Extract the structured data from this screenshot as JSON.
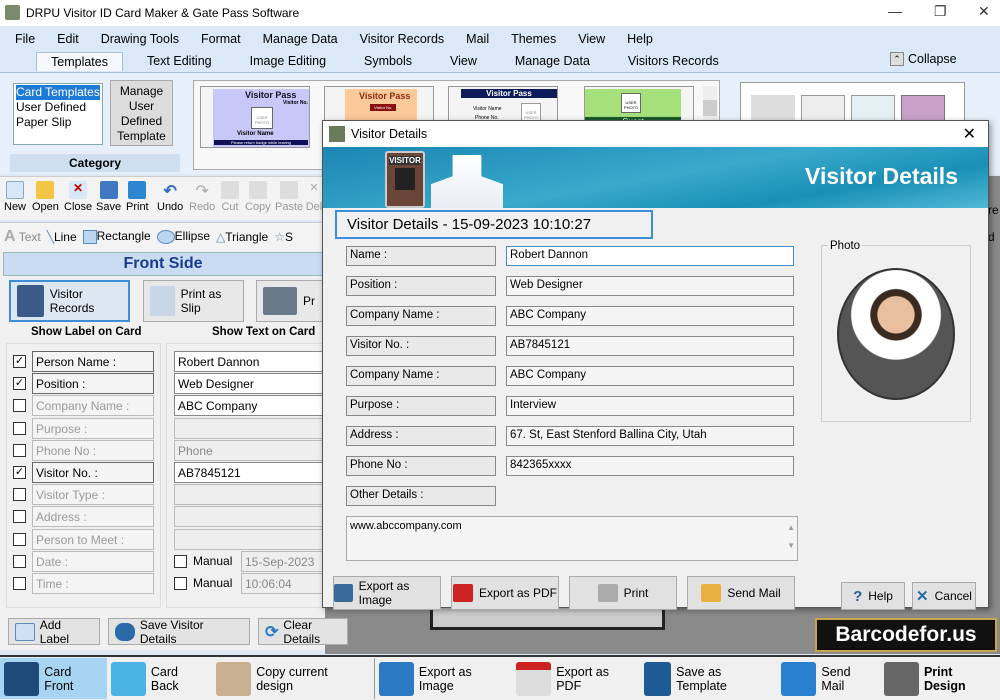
{
  "app": {
    "title": "DRPU Visitor ID Card Maker & Gate Pass Software"
  },
  "menu": [
    "File",
    "Edit",
    "Drawing Tools",
    "Format",
    "Manage Data",
    "Visitor Records",
    "Mail",
    "Themes",
    "View",
    "Help"
  ],
  "ribbon_tabs": [
    "Templates",
    "Text Editing",
    "Image Editing",
    "Symbols",
    "View",
    "Manage Data",
    "Visitors Records"
  ],
  "collapse_label": "Collapse",
  "category": {
    "items": [
      "Card Templates",
      "User Defined",
      "Paper Slip"
    ],
    "manage_button": "Manage User Defined Template",
    "label": "Category"
  },
  "templates": [
    {
      "title": "Visitor Pass",
      "sub": "Visitor No.",
      "name": "Visitor Name",
      "photo": "USER PHOTO",
      "footer": "Please return badge while leaving"
    },
    {
      "title": "Visitor Pass",
      "sub": "Visitor No."
    },
    {
      "title": "Visitor Pass",
      "name": "Visitor Name",
      "phone": "Phone No.",
      "photo": "USER PHOTO"
    },
    {
      "title": "Guest",
      "photo": "USER PHOTO"
    }
  ],
  "toolbar": [
    "New",
    "Open",
    "Close",
    "Save",
    "Print",
    "Undo",
    "Redo",
    "Cut",
    "Copy",
    "Paste",
    "Del"
  ],
  "drawing_tools": [
    "Text",
    "Line",
    "Rectangle",
    "Ellipse",
    "Triangle",
    "S"
  ],
  "left_panel": {
    "front_side": "Front Side",
    "visitor_records_button": "Visitor Records",
    "print_slip_button": "Print as Slip",
    "print_button_partial": "Pr",
    "col_label": "Show Label on Card",
    "col_text": "Show Text on Card",
    "rows": [
      {
        "label": "Person Name :",
        "checked": true,
        "text": "Robert Dannon"
      },
      {
        "label": "Position :",
        "checked": true,
        "text": "Web Designer"
      },
      {
        "label": "Company Name :",
        "checked": false,
        "text": "ABC Company"
      },
      {
        "label": "Purpose :",
        "checked": false,
        "text": ""
      },
      {
        "label": "Phone No :",
        "checked": false,
        "text": "Phone"
      },
      {
        "label": "Visitor No. :",
        "checked": true,
        "text": "AB7845121"
      },
      {
        "label": "Visitor Type :",
        "checked": false,
        "text": ""
      },
      {
        "label": "Address :",
        "checked": false,
        "text": ""
      },
      {
        "label": "Person to Meet :",
        "checked": false,
        "text": ""
      },
      {
        "label": "Date :",
        "checked": false,
        "text": "15-Sep-2023",
        "manual": "Manual"
      },
      {
        "label": "Time :",
        "checked": false,
        "text": "10:06:04",
        "manual": "Manual"
      }
    ],
    "add_label": "Add Label",
    "save_details": "Save Visitor Details",
    "clear_details": "Clear Details"
  },
  "bottom_bar": [
    "Card Front",
    "Card Back",
    "Copy current design",
    "Export as Image",
    "Export as PDF",
    "Save as Template",
    "Send Mail",
    "Print Design"
  ],
  "side_partial": [
    "re",
    "d"
  ],
  "logo": "Barcodefor.us",
  "dialog": {
    "title": "Visitor Details",
    "banner_title": "Visitor Details",
    "badge_text": "VISITOR",
    "header": "Visitor Details - 15-09-2023 10:10:27",
    "photo_label": "Photo",
    "fields": [
      {
        "label": "Name :",
        "value": "Robert Dannon"
      },
      {
        "label": "Position :",
        "value": "Web Designer"
      },
      {
        "label": "Company Name :",
        "value": "ABC Company"
      },
      {
        "label": "Visitor No. :",
        "value": "AB7845121"
      },
      {
        "label": "Company Name :",
        "value": "ABC Company"
      },
      {
        "label": "Purpose :",
        "value": "Interview"
      },
      {
        "label": "Address :",
        "value": "67. St, East Stenford Ballina City, Utah"
      },
      {
        "label": "Phone No :",
        "value": "842365xxxx"
      },
      {
        "label": "Other Details :",
        "value": "www.abccompany.com"
      }
    ],
    "buttons": [
      "Export as Image",
      "Export as PDF",
      "Print",
      "Send Mail",
      "Help",
      "Cancel"
    ]
  },
  "colors": {
    "accent": "#1e7ad7",
    "banner": "#1b86b3",
    "selected_tab": "#a7d4f2"
  }
}
